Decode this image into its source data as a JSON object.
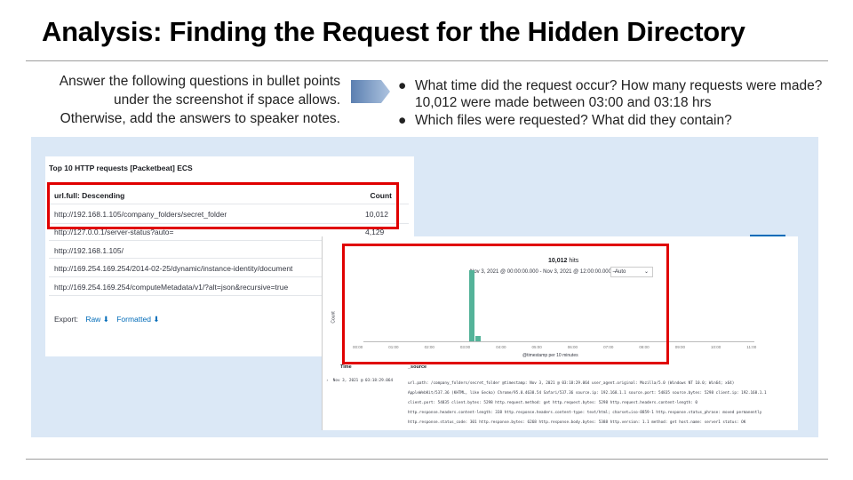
{
  "slide": {
    "title": "Analysis: Finding the Request for the Hidden Directory",
    "instructions": [
      "Answer the following questions in bullet points",
      "under the screenshot if space allows.",
      "Otherwise, add the answers to speaker notes."
    ],
    "questions": [
      {
        "bullet": "●",
        "text": "What time did the request occur? How many requests were made?",
        "answer": "10,012 were made between 03:00 and 03:18 hrs"
      },
      {
        "bullet": "●",
        "text": "Which files were requested? What did they contain?",
        "answer": ""
      }
    ],
    "colors": {
      "highlight_box": "#e00000",
      "screenshot_bg": "#dbe8f6",
      "bar": "#54b399",
      "link": "#006bb8"
    }
  },
  "table_panel": {
    "title": "Top 10 HTTP requests [Packetbeat] ECS",
    "col_url": "url.full: Descending",
    "col_count": "Count",
    "rows": [
      {
        "url": "http://192.168.1.105/company_folders/secret_folder",
        "count": "10,012"
      },
      {
        "url": "http://127.0.0.1/server-status?auto=",
        "count": "4,129"
      },
      {
        "url": "http://192.168.1.105/",
        "count": ""
      },
      {
        "url": "http://169.254.169.254/2014-02-25/dynamic/instance-identity/document",
        "count": ""
      },
      {
        "url": "http://169.254.169.254/computeMetadata/v1/?alt=json&recursive=true",
        "count": ""
      }
    ],
    "export_label": "Export:",
    "raw_label": "Raw",
    "formatted_label": "Formatted"
  },
  "discover_panel": {
    "hits": "10,012",
    "hits_label": "hits",
    "range": "Nov 3, 2021 @ 00:00:00.000 - Nov 3, 2021 @ 12:00:00.000 —",
    "interval": "Auto",
    "y_label": "Count",
    "x_label": "@timestamp per 10 minutes",
    "col_time": "Time",
    "col_source": "_source",
    "doc_time": "Nov 3, 2021 @ 03:18:29.064",
    "source_lines": [
      "url.path: /company_folders/secret_folder @timestamp: Nov 3, 2021 @ 03:18:29.064 user_agent.original: Mozilla/5.0 (Windows NT 10.0; Win64; x64)",
      "AppleWebKit/537.36 (KHTML, like Gecko) Chrome/95.0.4638.54 Safari/537.36 source.ip: 192.168.1.1 source.port: 54835 source.bytes: 5298 client.ip: 192.168.1.1",
      "client.port: 54835 client.bytes: 5298 http.request.method: get http.request.bytes: 5298 http.request.headers.content-length: 0",
      "http.response.headers.content-length: 338 http.response.headers.content-type: text/html; charset=iso-8859-1 http.response.status_phrase: moved permanently",
      "http.response.status_code: 301 http.response.bytes: 6268 http.response.body.bytes: 5388 http.version: 1.1 method: get host.name: server1 status: OK"
    ]
  },
  "chart_data": {
    "type": "bar",
    "x": [
      "00:00",
      "01:00",
      "02:00",
      "03:00",
      "04:00",
      "05:00",
      "06:00",
      "07:00",
      "08:00",
      "09:00",
      "10:00",
      "11:00"
    ],
    "bars": [
      {
        "x": "03:00",
        "value": 10012
      },
      {
        "x": "03:10",
        "value": 800
      }
    ],
    "xlabel": "@timestamp per 10 minutes",
    "ylabel": "Count"
  }
}
